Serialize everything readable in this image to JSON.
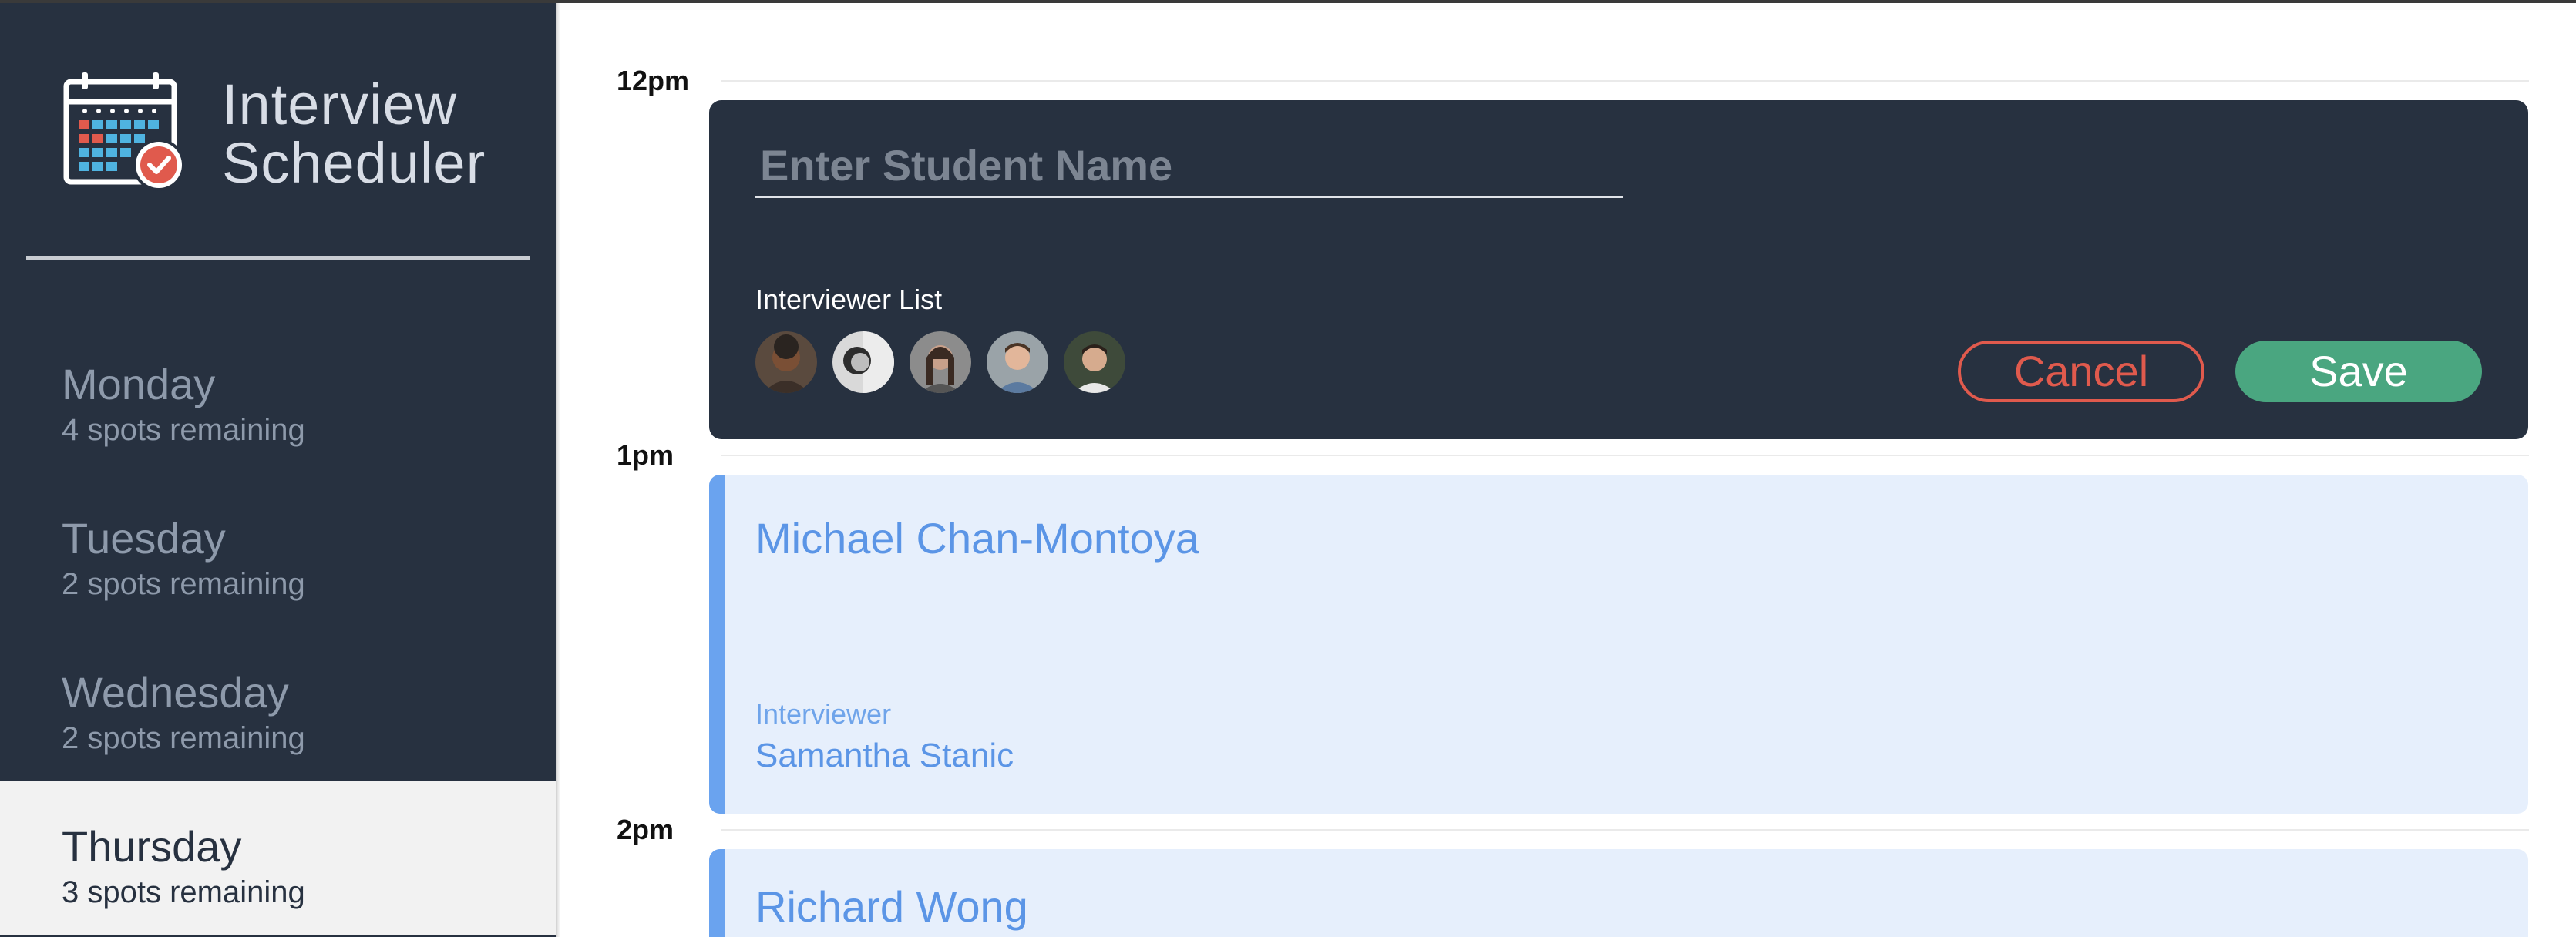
{
  "app": {
    "title_line1": "Interview",
    "title_line2": "Scheduler",
    "logo_icon": "calendar-check-icon"
  },
  "sidebar": {
    "days": [
      {
        "name": "Monday",
        "spots": "4 spots remaining",
        "selected": false
      },
      {
        "name": "Tuesday",
        "spots": "2 spots remaining",
        "selected": false
      },
      {
        "name": "Wednesday",
        "spots": "2 spots remaining",
        "selected": false
      },
      {
        "name": "Thursday",
        "spots": "3 spots remaining",
        "selected": true
      }
    ]
  },
  "schedule": {
    "hours": [
      "12pm",
      "1pm",
      "2pm"
    ],
    "form": {
      "student_placeholder": "Enter Student Name",
      "student_value": "",
      "interviewer_list_label": "Interviewer List",
      "interviewers": [
        "avatar-1",
        "avatar-2",
        "avatar-3",
        "avatar-4",
        "avatar-5"
      ],
      "cancel_label": "Cancel",
      "save_label": "Save"
    },
    "appointments": [
      {
        "student": "Michael Chan-Montoya",
        "interviewer_label": "Interviewer",
        "interviewer": "Samantha Stanic"
      },
      {
        "student": "Richard Wong"
      }
    ]
  },
  "colors": {
    "sidebar_bg": "#273140",
    "selected_day_bg": "#f2f2f2",
    "cancel": "#e05a4d",
    "save": "#4aa680",
    "appointment_bg": "#e6effc",
    "appointment_accent": "#6aa3ef"
  }
}
